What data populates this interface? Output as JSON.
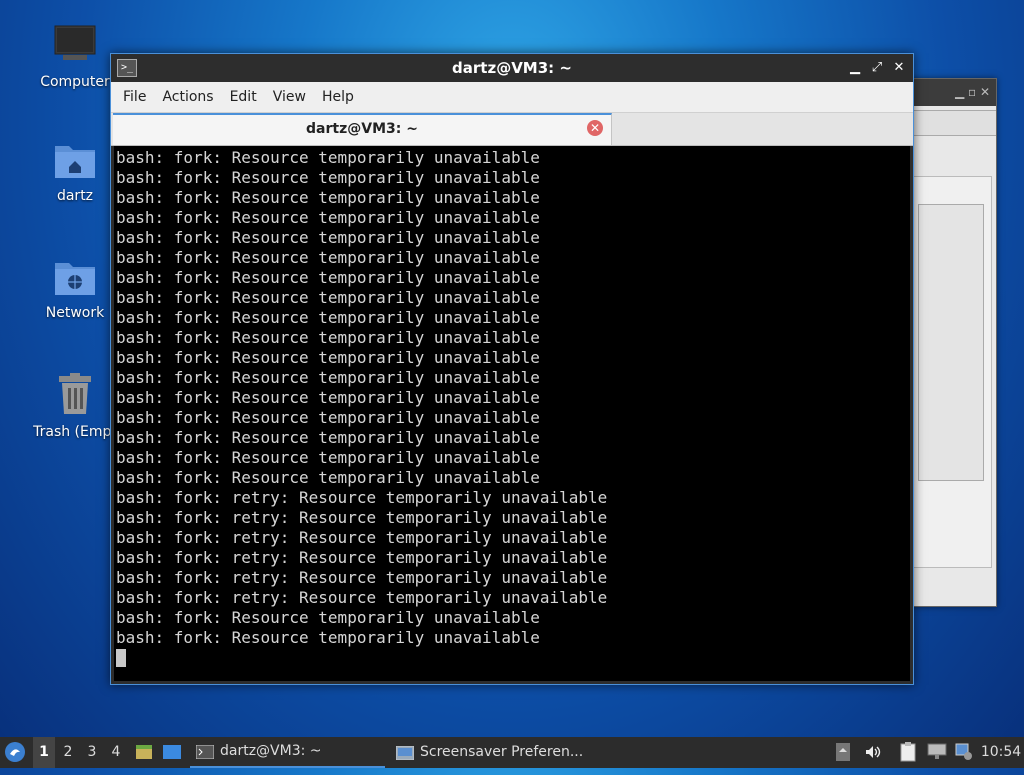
{
  "desktop": {
    "icons": [
      {
        "label": "Computer",
        "icon": "computer-icon"
      },
      {
        "label": "dartz",
        "icon": "home-folder-icon"
      },
      {
        "label": "Network",
        "icon": "network-folder-icon"
      },
      {
        "label": "Trash (Empt",
        "icon": "trash-icon"
      }
    ]
  },
  "terminal": {
    "title": "dartz@VM3: ~",
    "menu": [
      "File",
      "Actions",
      "Edit",
      "View",
      "Help"
    ],
    "tab_label": "dartz@VM3: ~",
    "lines": [
      "bash: fork: Resource temporarily unavailable",
      "bash: fork: Resource temporarily unavailable",
      "bash: fork: Resource temporarily unavailable",
      "bash: fork: Resource temporarily unavailable",
      "bash: fork: Resource temporarily unavailable",
      "bash: fork: Resource temporarily unavailable",
      "bash: fork: Resource temporarily unavailable",
      "bash: fork: Resource temporarily unavailable",
      "bash: fork: Resource temporarily unavailable",
      "bash: fork: Resource temporarily unavailable",
      "bash: fork: Resource temporarily unavailable",
      "bash: fork: Resource temporarily unavailable",
      "bash: fork: Resource temporarily unavailable",
      "bash: fork: Resource temporarily unavailable",
      "bash: fork: Resource temporarily unavailable",
      "bash: fork: Resource temporarily unavailable",
      "bash: fork: Resource temporarily unavailable",
      "bash: fork: retry: Resource temporarily unavailable",
      "bash: fork: retry: Resource temporarily unavailable",
      "bash: fork: retry: Resource temporarily unavailable",
      "bash: fork: retry: Resource temporarily unavailable",
      "bash: fork: retry: Resource temporarily unavailable",
      "bash: fork: retry: Resource temporarily unavailable",
      "bash: fork: Resource temporarily unavailable",
      "bash: fork: Resource temporarily unavailable"
    ]
  },
  "taskbar": {
    "workspaces": [
      "1",
      "2",
      "3",
      "4"
    ],
    "active_workspace": "1",
    "tasks": [
      {
        "label": "dartz@VM3: ~",
        "icon": "terminal-icon",
        "active": true
      },
      {
        "label": "Screensaver Preferen...",
        "icon": "screensaver-icon",
        "active": false
      }
    ],
    "clock": "10:54"
  },
  "colors": {
    "accent": "#4a90d9",
    "terminal_bg": "#000000",
    "terminal_fg": "#d6d6d6",
    "taskbar_bg": "#2c2c2c"
  }
}
